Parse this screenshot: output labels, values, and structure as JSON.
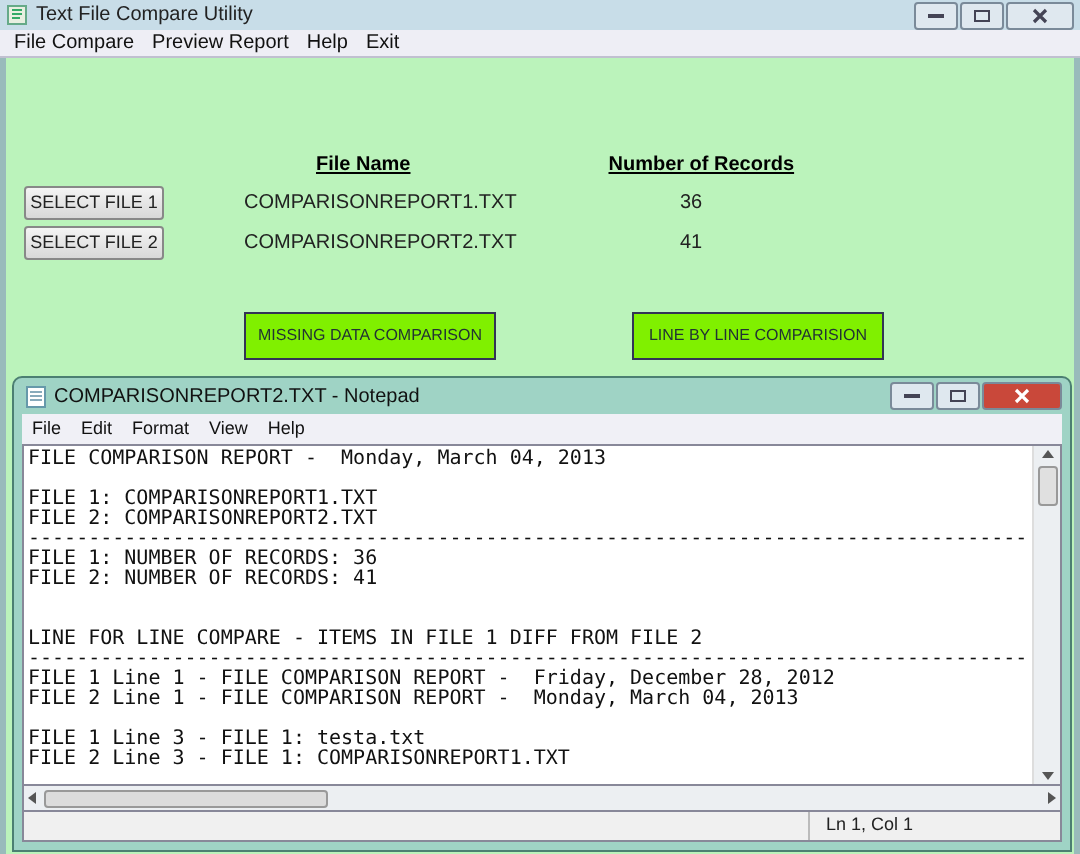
{
  "window": {
    "title": "Text File Compare Utility"
  },
  "menu": [
    "File Compare",
    "Preview Report",
    "Help",
    "Exit"
  ],
  "table": {
    "columns": [
      "File Name",
      "Number of Records"
    ],
    "rows": [
      {
        "button": "SELECT FILE 1",
        "file": "COMPARISONREPORT1.TXT",
        "records": "36"
      },
      {
        "button": "SELECT FILE 2",
        "file": "COMPARISONREPORT2.TXT",
        "records": "41"
      }
    ]
  },
  "actions": [
    "MISSING DATA COMPARISON",
    "LINE BY LINE COMPARISION"
  ],
  "notepad": {
    "title": "COMPARISONREPORT2.TXT - Notepad",
    "menu": [
      "File",
      "Edit",
      "Format",
      "View",
      "Help"
    ],
    "lines": [
      {
        "kind": "text",
        "text": "FILE COMPARISON REPORT -  Monday, March 04, 2013"
      },
      {
        "kind": "blank"
      },
      {
        "kind": "text",
        "text": "FILE 1: COMPARISONREPORT1.TXT"
      },
      {
        "kind": "text",
        "text": "FILE 2: COMPARISONREPORT2.TXT"
      },
      {
        "kind": "rule",
        "text": "-----------------------------------------------------------------------------------"
      },
      {
        "kind": "text",
        "text": "FILE 1: NUMBER OF RECORDS: 36"
      },
      {
        "kind": "text",
        "text": "FILE 2: NUMBER OF RECORDS: 41"
      },
      {
        "kind": "blank"
      },
      {
        "kind": "blank"
      },
      {
        "kind": "text",
        "text": "LINE FOR LINE COMPARE - ITEMS IN FILE 1 DIFF FROM FILE 2"
      },
      {
        "kind": "rule",
        "text": "-----------------------------------------------------------------------------------"
      },
      {
        "kind": "text",
        "text": "FILE 1 Line 1 - FILE COMPARISON REPORT -  Friday, December 28, 2012"
      },
      {
        "kind": "text",
        "text": "FILE 2 Line 1 - FILE COMPARISON REPORT -  Monday, March 04, 2013"
      },
      {
        "kind": "blank"
      },
      {
        "kind": "text",
        "text": "FILE 1 Line 3 - FILE 1: testa.txt"
      },
      {
        "kind": "text",
        "text": "FILE 2 Line 3 - FILE 1: COMPARISONREPORT1.TXT"
      }
    ],
    "status": "Ln 1, Col 1"
  }
}
